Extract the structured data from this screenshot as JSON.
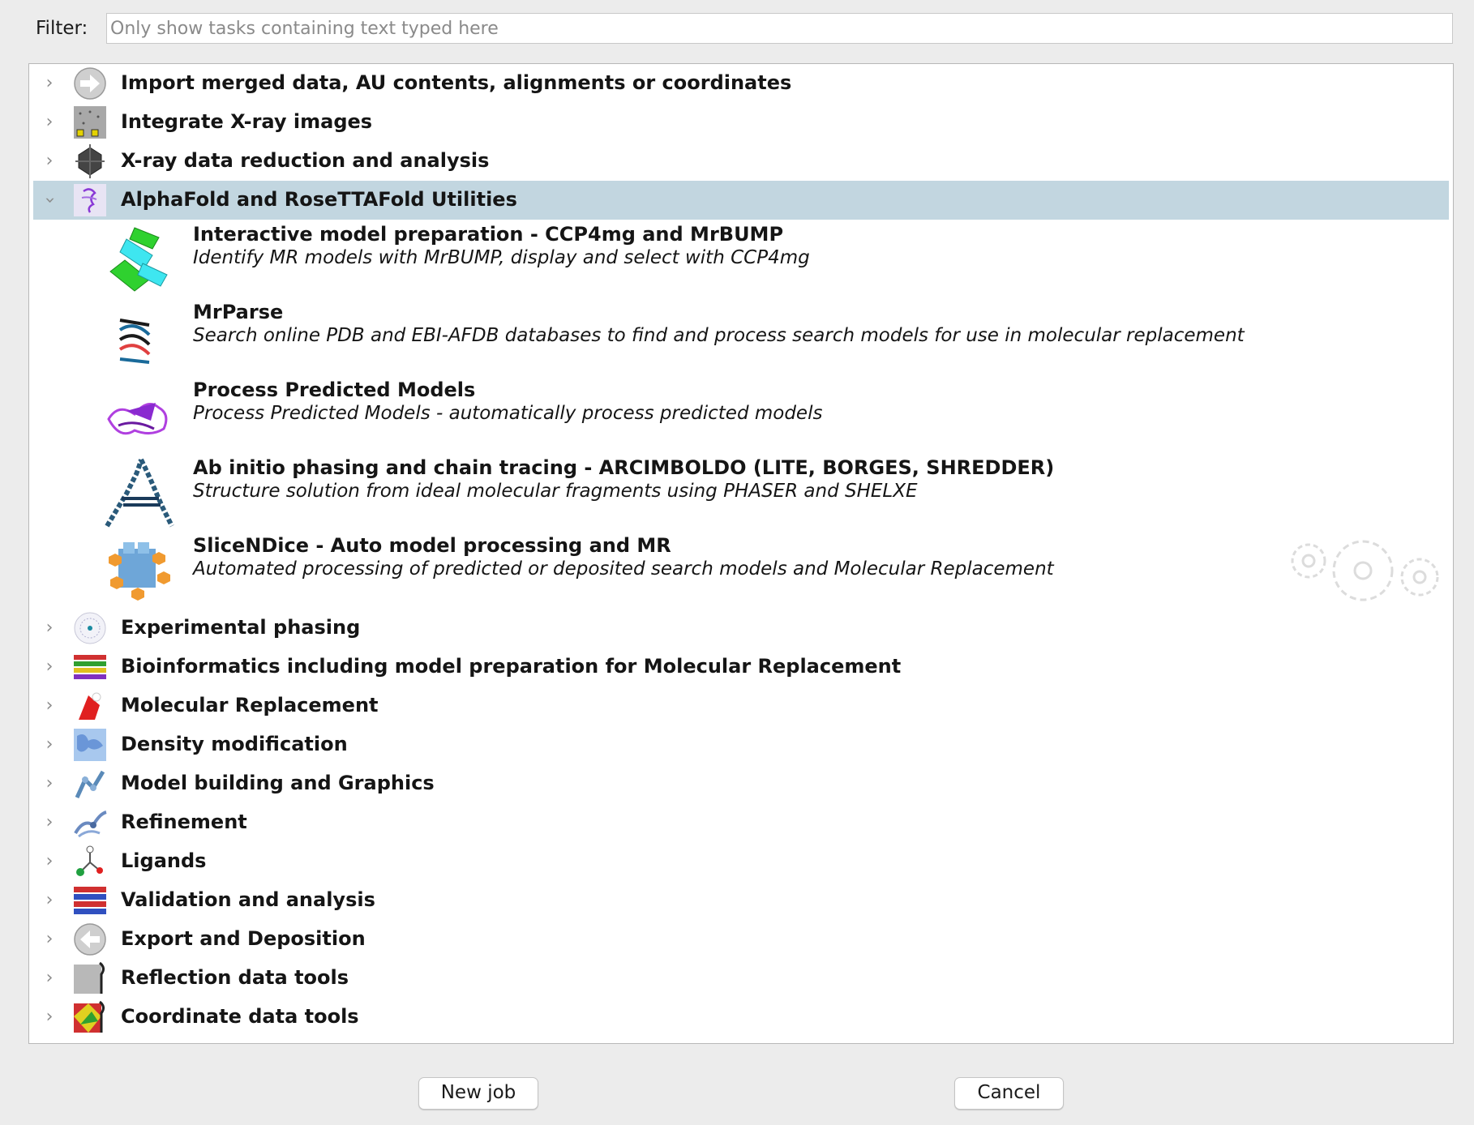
{
  "filter": {
    "label": "Filter:",
    "placeholder": "Only show tasks containing text typed here",
    "value": ""
  },
  "categories": [
    {
      "label": "Import merged data, AU contents, alignments or coordinates",
      "icon": "import-arrow-icon",
      "expanded": false
    },
    {
      "label": "Integrate X-ray images",
      "icon": "diffraction-image-icon",
      "expanded": false
    },
    {
      "label": "X-ray data reduction and analysis",
      "icon": "crystal-icon",
      "expanded": false
    },
    {
      "label": "AlphaFold and RoseTTAFold Utilities",
      "icon": "alphafold-icon",
      "expanded": true,
      "selected": true
    },
    {
      "label": "Experimental phasing",
      "icon": "phasing-icon",
      "expanded": false
    },
    {
      "label": "Bioinformatics including model preparation for Molecular Replacement",
      "icon": "alignment-icon",
      "expanded": false
    },
    {
      "label": "Molecular Replacement",
      "icon": "molecular-replacement-icon",
      "expanded": false
    },
    {
      "label": "Density modification",
      "icon": "density-icon",
      "expanded": false
    },
    {
      "label": "Model building and Graphics",
      "icon": "model-building-icon",
      "expanded": false
    },
    {
      "label": "Refinement",
      "icon": "refinement-icon",
      "expanded": false
    },
    {
      "label": "Ligands",
      "icon": "ligand-icon",
      "expanded": false
    },
    {
      "label": "Validation and analysis",
      "icon": "validation-icon",
      "expanded": false
    },
    {
      "label": "Export and Deposition",
      "icon": "export-arrow-icon",
      "expanded": false
    },
    {
      "label": "Reflection data tools",
      "icon": "reflection-tools-icon",
      "expanded": false
    },
    {
      "label": "Coordinate data tools",
      "icon": "coordinate-tools-icon",
      "expanded": false
    }
  ],
  "tasks": [
    {
      "title": "Interactive model preparation - CCP4mg and MrBUMP",
      "description": "Identify MR models with MrBUMP, display and select with CCP4mg",
      "icon": "ccp4mg-mrbump-icon"
    },
    {
      "title": "MrParse",
      "description": "Search online PDB and EBI-AFDB databases to find and process search models for use in molecular replacement",
      "icon": "mrparse-icon"
    },
    {
      "title": "Process Predicted Models",
      "description": "Process Predicted Models - automatically process predicted models",
      "icon": "process-predicted-models-icon"
    },
    {
      "title": "Ab initio phasing and chain tracing - ARCIMBOLDO (LITE, BORGES, SHREDDER)",
      "description": "Structure solution from ideal molecular fragments using PHASER and SHELXE",
      "icon": "arcimboldo-icon"
    },
    {
      "title": "SliceNDice - Auto model processing and MR",
      "description": "Automated processing of predicted or deposited search models and Molecular Replacement",
      "icon": "slicendice-icon"
    }
  ],
  "buttons": {
    "new_job": "New job",
    "cancel": "Cancel"
  },
  "colors": {
    "selected_row": "#c2d6e0",
    "window_bg": "#ececec"
  }
}
